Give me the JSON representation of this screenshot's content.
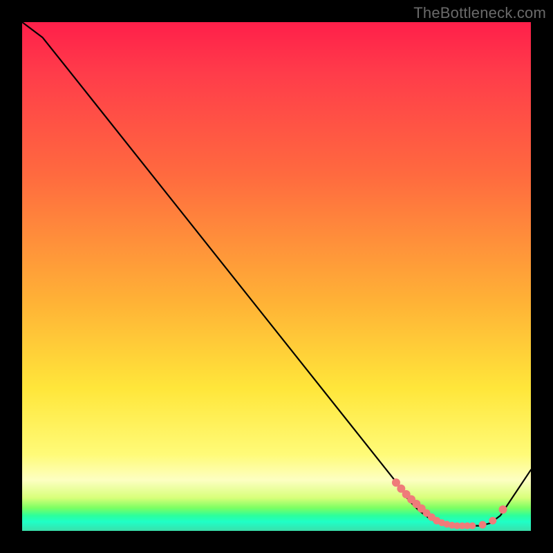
{
  "watermark": "TheBottleneck.com",
  "colors": {
    "marker": "#ef7b7a",
    "line": "#000000"
  },
  "chart_data": {
    "type": "line",
    "title": "",
    "xlabel": "",
    "ylabel": "",
    "xlim": [
      0,
      100
    ],
    "ylim": [
      0,
      100
    ],
    "grid": false,
    "series": [
      {
        "name": "bottleneck-curve",
        "x": [
          0,
          4,
          8,
          74,
          76,
          78,
          80,
          82,
          84,
          86,
          88,
          90,
          92,
          94,
          100
        ],
        "values": [
          100,
          97,
          92,
          9,
          6,
          4,
          2.5,
          1.5,
          1,
          1,
          1,
          1,
          1.5,
          3,
          12
        ]
      }
    ],
    "markers": {
      "name": "highlight-points",
      "x": [
        73.5,
        74.5,
        75.5,
        76.5,
        77.5,
        78.5,
        79.5,
        80.5,
        81.5,
        82.5,
        83.5,
        84.5,
        85.5,
        86.5,
        87.5,
        88.5,
        90.5,
        92.5,
        94.5
      ],
      "values": [
        9.5,
        8.3,
        7.2,
        6.2,
        5.3,
        4.4,
        3.5,
        2.7,
        2.0,
        1.6,
        1.3,
        1.1,
        1.0,
        1.0,
        1.0,
        1.0,
        1.2,
        2.0,
        4.2
      ],
      "size": [
        6,
        6,
        6,
        6,
        6,
        6,
        5.5,
        5.5,
        5.5,
        5,
        5,
        5,
        5,
        5,
        5,
        5,
        5.5,
        5.5,
        6
      ]
    }
  }
}
